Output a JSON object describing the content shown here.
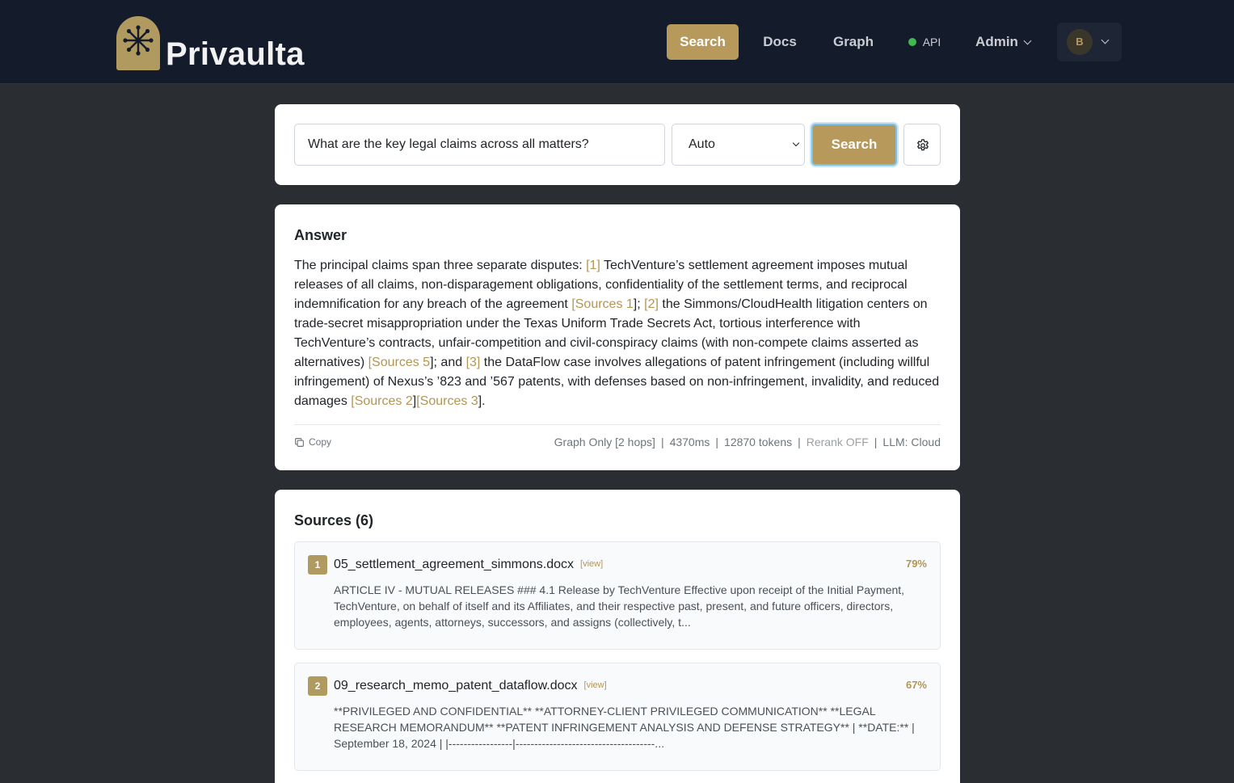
{
  "brand": {
    "name": "Privaulta"
  },
  "nav": {
    "search": "Search",
    "docs": "Docs",
    "graph": "Graph",
    "api": "API",
    "admin": "Admin",
    "avatar_initial": "B",
    "api_status_color": "#3fb950"
  },
  "search": {
    "query": "What are the key legal claims across all matters?",
    "mode": "Auto",
    "button": "Search"
  },
  "answer": {
    "title": "Answer",
    "parts": [
      "The principal claims span three separate disputes: ",
      "[1]",
      " TechVenture’s settlement agreement imposes mutual releases of all claims, non-disparagement obligations, confidentiality of the settlement terms, and reciprocal indemnification for any breach of the agreement ",
      "[Sources 1",
      "]; ",
      "[2]",
      " the Simmons/CloudHealth litigation centers on trade-secret misappropriation under the Texas Uniform Trade Secrets Act, tortious interference with TechVenture’s contracts, unfair-competition and civil-conspiracy claims (with non-compete claims asserted as alternatives) ",
      "[Sources 5",
      "]; and ",
      "[3]",
      " the DataFlow case involves allegations of patent infringement (including willful infringement) of Nexus’s ’823 and ’567 patents, with defenses based on non-infringement, invalidity, and reduced damages ",
      "[Sources 2",
      "]",
      "[Sources 3",
      "]."
    ],
    "copy": "Copy",
    "meta": {
      "mode": "Graph Only [2 hops]",
      "latency": "4370ms",
      "tokens": "12870 tokens",
      "rerank": "Rerank OFF",
      "llm": "LLM: Cloud",
      "separator": "|"
    }
  },
  "sources": {
    "title": "Sources (6)",
    "items": [
      {
        "num": "1",
        "name": "05_settlement_agreement_simmons.docx",
        "view": "[view]",
        "score": "79%",
        "snippet": "ARTICLE IV - MUTUAL RELEASES ### 4.1 Release by TechVenture Effective upon receipt of the Initial Payment, TechVenture, on behalf of itself and its Affiliates, and their respective past, present, and future officers, directors, employees, agents, attorneys, successors, and assigns (collectively, t..."
      },
      {
        "num": "2",
        "name": "09_research_memo_patent_dataflow.docx",
        "view": "[view]",
        "score": "67%",
        "snippet": "**PRIVILEGED AND CONFIDENTIAL** **ATTORNEY-CLIENT PRIVILEGED COMMUNICATION** **LEGAL RESEARCH MEMORANDUM** **PATENT INFRINGEMENT ANALYSIS AND DEFENSE STRATEGY** | **DATE:** | September 18, 2024 | |-----------------|-------------------------------------..."
      }
    ]
  }
}
